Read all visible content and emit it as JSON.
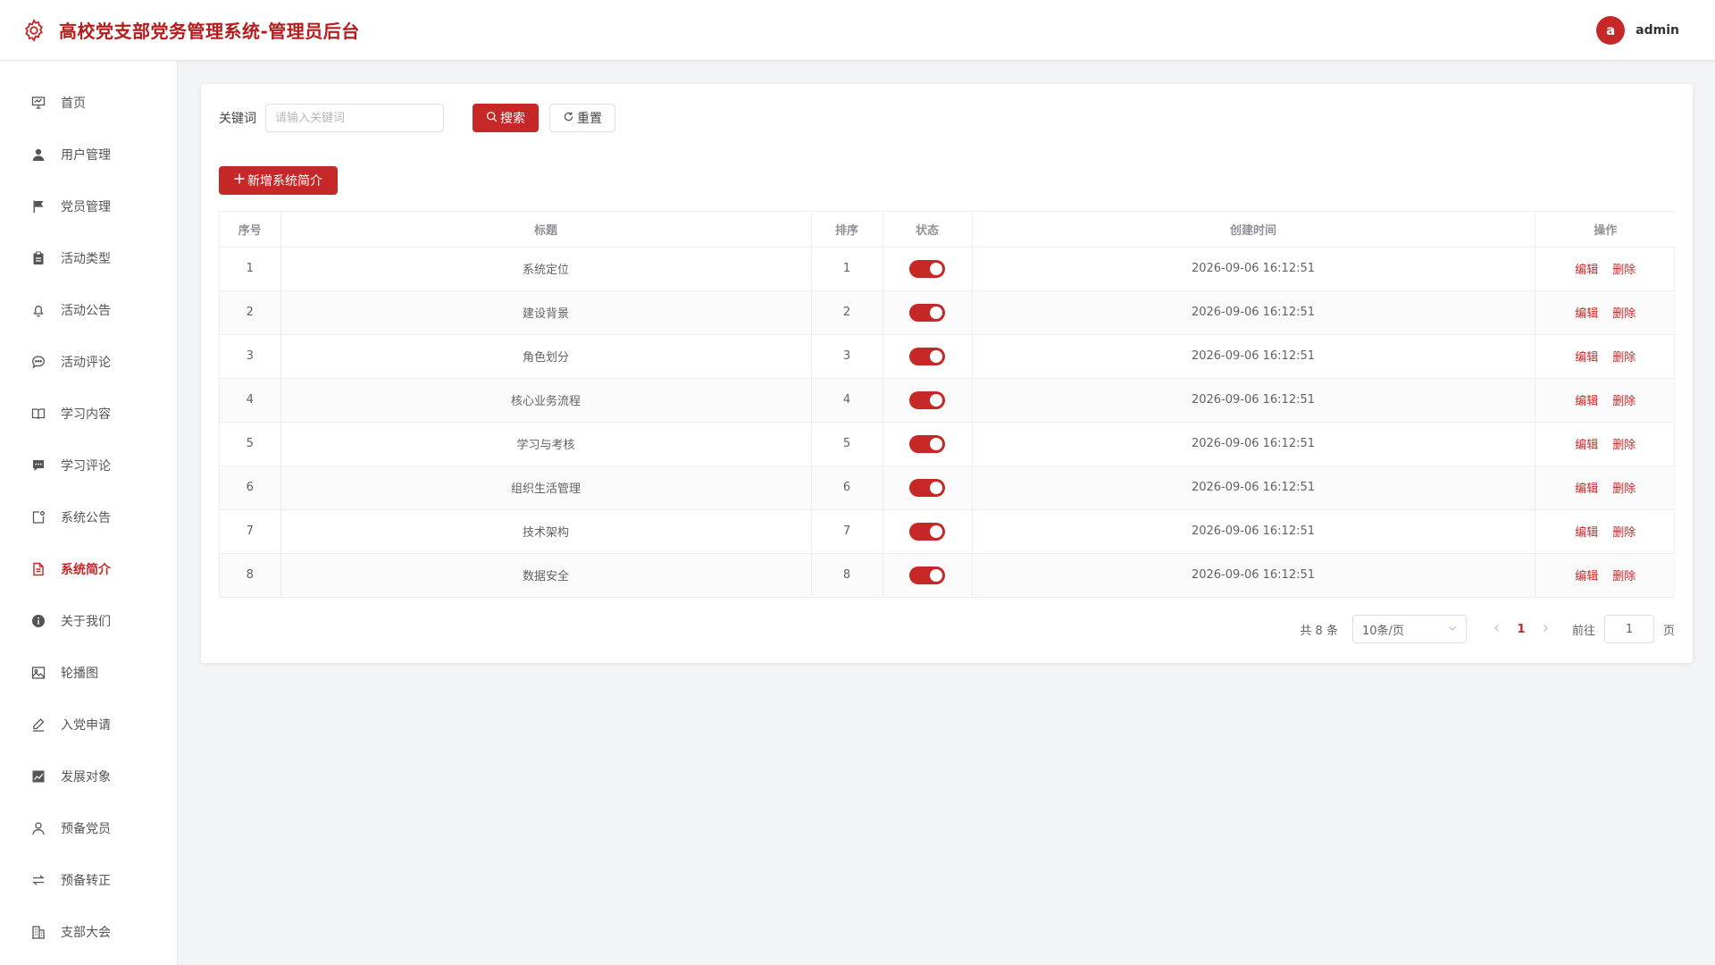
{
  "header": {
    "title": "高校党支部党务管理系统-管理员后台",
    "avatar_letter": "a",
    "username": "admin",
    "accent_color": "#c62828"
  },
  "sidebar": {
    "items": [
      {
        "label": "首页",
        "icon": "presentation-icon",
        "active": false
      },
      {
        "label": "用户管理",
        "icon": "user-icon",
        "active": false
      },
      {
        "label": "党员管理",
        "icon": "flag-icon",
        "active": false
      },
      {
        "label": "活动类型",
        "icon": "clipboard-icon",
        "active": false
      },
      {
        "label": "活动公告",
        "icon": "bell-icon",
        "active": false
      },
      {
        "label": "活动评论",
        "icon": "chat-bubble-icon",
        "active": false
      },
      {
        "label": "学习内容",
        "icon": "book-icon",
        "active": false
      },
      {
        "label": "学习评论",
        "icon": "comment-icon",
        "active": false
      },
      {
        "label": "系统公告",
        "icon": "notice-icon",
        "active": false
      },
      {
        "label": "系统简介",
        "icon": "document-icon",
        "active": true
      },
      {
        "label": "关于我们",
        "icon": "info-icon",
        "active": false
      },
      {
        "label": "轮播图",
        "icon": "picture-icon",
        "active": false
      },
      {
        "label": "入党申请",
        "icon": "pen-icon",
        "active": false
      },
      {
        "label": "发展对象",
        "icon": "trend-chart-icon",
        "active": false
      },
      {
        "label": "预备党员",
        "icon": "user-outline-icon",
        "active": false
      },
      {
        "label": "预备转正",
        "icon": "switch-arrows-icon",
        "active": false
      },
      {
        "label": "支部大会",
        "icon": "office-building-icon",
        "active": false
      }
    ]
  },
  "search": {
    "label": "关键词",
    "placeholder": "请输入关键词",
    "value": "",
    "search_label": "搜索",
    "reset_label": "重置"
  },
  "toolbar": {
    "add_label": "新增系统简介"
  },
  "table": {
    "columns": [
      "序号",
      "标题",
      "排序",
      "状态",
      "创建时间",
      "操作"
    ],
    "edit_label": "编辑",
    "delete_label": "删除",
    "rows": [
      {
        "index": "1",
        "title": "系统定位",
        "sort": "1",
        "status": true,
        "created": "2026-09-06 16:12:51"
      },
      {
        "index": "2",
        "title": "建设背景",
        "sort": "2",
        "status": true,
        "created": "2026-09-06 16:12:51"
      },
      {
        "index": "3",
        "title": "角色划分",
        "sort": "3",
        "status": true,
        "created": "2026-09-06 16:12:51"
      },
      {
        "index": "4",
        "title": "核心业务流程",
        "sort": "4",
        "status": true,
        "created": "2026-09-06 16:12:51"
      },
      {
        "index": "5",
        "title": "学习与考核",
        "sort": "5",
        "status": true,
        "created": "2026-09-06 16:12:51"
      },
      {
        "index": "6",
        "title": "组织生活管理",
        "sort": "6",
        "status": true,
        "created": "2026-09-06 16:12:51"
      },
      {
        "index": "7",
        "title": "技术架构",
        "sort": "7",
        "status": true,
        "created": "2026-09-06 16:12:51"
      },
      {
        "index": "8",
        "title": "数据安全",
        "sort": "8",
        "status": true,
        "created": "2026-09-06 16:12:51"
      }
    ]
  },
  "pagination": {
    "total_text": "共 8 条",
    "page_size": "10条/页",
    "current_page": "1",
    "goto_label": "前往",
    "goto_value": "1",
    "page_unit": "页"
  }
}
